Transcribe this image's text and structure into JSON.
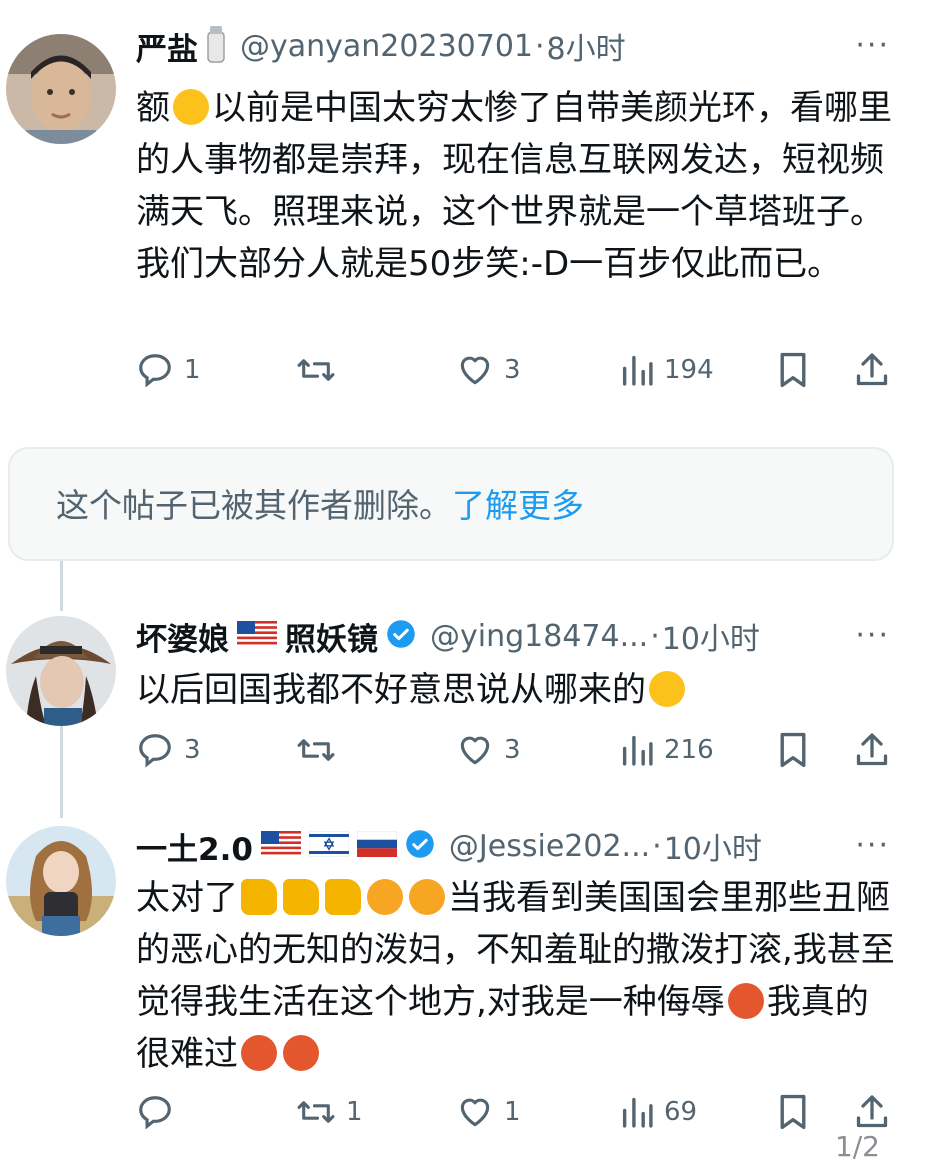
{
  "posts": [
    {
      "name": "严盐",
      "handle": "@yanyan20230701",
      "sep": "·",
      "time": "8小时",
      "more": "···",
      "text_a": "额",
      "text_b": "以前是中国太穷太惨了自带美颜光环，看哪里的人事物都是崇拜，现在信息互联网发达，短视频满天飞。照理来说，这个世界就是一个草塔班子。我们大部分人就是50步笑:-D一百步仅此而已。",
      "reply_count": "1",
      "retweet_count": "",
      "like_count": "3",
      "view_count": "194"
    },
    {
      "name": "坏婆娘",
      "name_b": "照妖镜",
      "handle": "@ying18474...",
      "sep": "·",
      "time": "10小时",
      "more": "···",
      "text": "以后回国我都不好意思说从哪来的",
      "reply_count": "3",
      "retweet_count": "",
      "like_count": "3",
      "view_count": "216"
    },
    {
      "name": "一土2.0",
      "handle": "@Jessie202...",
      "sep": "·",
      "time": "10小时",
      "more": "···",
      "text_a": "太对了",
      "text_b": "当我看到美国国会里那些丑陋的恶心的无知的泼妇，不知羞耻的撒泼打滚,我甚至觉得我生活在这个地方,对我是一种侮辱",
      "text_c": "我真的很难过",
      "reply_count": "",
      "retweet_count": "1",
      "like_count": "1",
      "view_count": "69"
    }
  ],
  "deleted_notice": {
    "message": "这个帖子已被其作者删除。",
    "learn_more": "了解更多"
  },
  "pager": "1/2",
  "colors": {
    "text": "#0f1419",
    "secondary": "#536471",
    "link": "#1d9bf0",
    "verified": "#1d9bf0"
  }
}
